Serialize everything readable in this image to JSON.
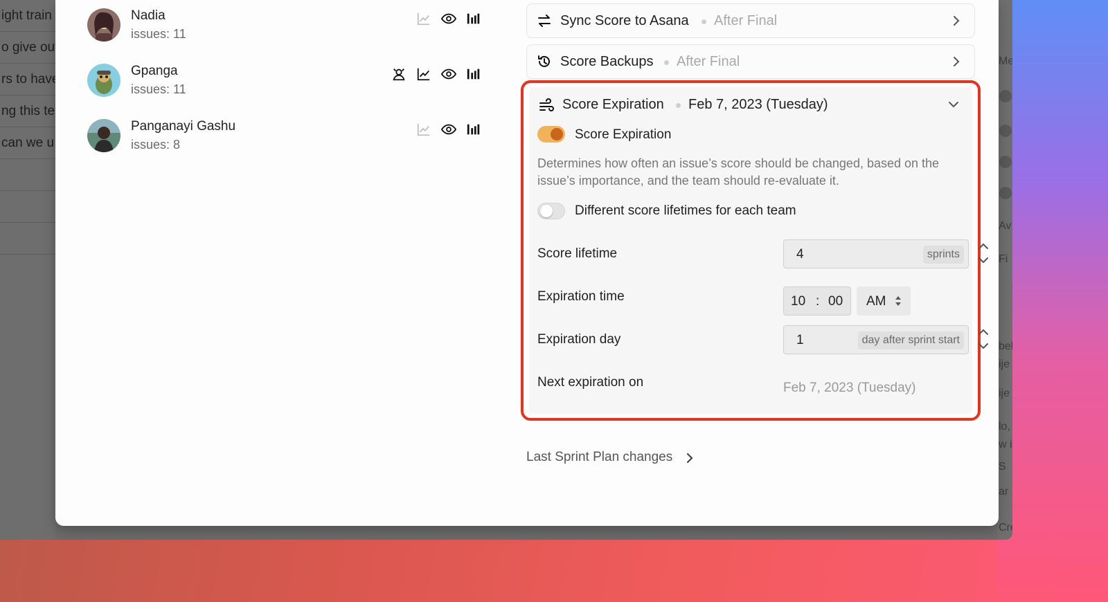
{
  "background_list": {
    "items": [
      "ight train",
      "o give out",
      "rs to have",
      "ng this te",
      "can we u",
      "",
      "",
      ""
    ]
  },
  "background_right": {
    "texts": [
      "Me",
      "Av",
      "Fi",
      "bel",
      "ije",
      "ije",
      "lo,",
      "w i",
      "S",
      "ar",
      "Creat"
    ]
  },
  "members": [
    {
      "name": "Nadia",
      "issues": "issues: 11"
    },
    {
      "name": "Gpanga",
      "issues": "issues: 11"
    },
    {
      "name": "Panganayi Gashu",
      "issues": "issues: 8"
    }
  ],
  "integrations": {
    "sync": {
      "title": "Sync Score to Asana",
      "subtitle": "After Final"
    },
    "backups": {
      "title": "Score Backups",
      "subtitle": "After Final"
    }
  },
  "expiration": {
    "title": "Score Expiration",
    "date": "Feb 7, 2023 (Tuesday)",
    "toggle_label": "Score Expiration",
    "toggle_on": true,
    "description": "Determines how often an issue’s score should be changed, based on the issue’s importance, and the team should re-evaluate it.",
    "per_team_label": "Different score lifetimes for each team",
    "per_team_on": false,
    "lifetime_label": "Score lifetime",
    "lifetime_value": "4",
    "lifetime_unit": "sprints",
    "time_label": "Expiration time",
    "time_hour": "10",
    "time_sep": ":",
    "time_minute": "00",
    "time_ampm": "AM",
    "day_label": "Expiration day",
    "day_value": "1",
    "day_unit": "day after sprint start",
    "next_label": "Next expiration on",
    "next_value": "Feb 7, 2023 (Tuesday)"
  },
  "footer": {
    "last_changes": "Last Sprint Plan changes"
  },
  "colors": {
    "accent_toggle": "#f1b25a",
    "highlight_outline": "#e8321c"
  }
}
